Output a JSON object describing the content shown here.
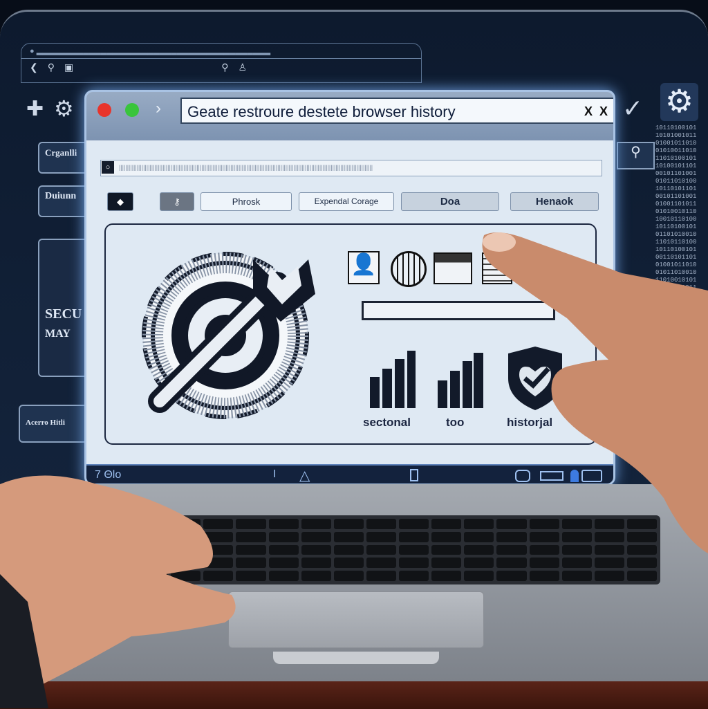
{
  "window": {
    "title": "Geate restroure destete browser history",
    "close_labels": [
      "X",
      "X"
    ]
  },
  "background_ui": {
    "left_buttons": [
      "Crganlli",
      "Duiunn",
      "SECU",
      "MAY",
      "Acerro Hitli"
    ],
    "right_icon": "gear-icon"
  },
  "toolbar": {
    "buttons": [
      "Phrosk",
      "Expendal Corage",
      "Doa",
      "Henaok"
    ]
  },
  "panel": {
    "labels": [
      "sectonal",
      "too",
      "historjal"
    ],
    "progress_fraction": 0
  },
  "statusbar": {
    "left_text": "7  Θlo"
  },
  "colors": {
    "close_dot": "#e8342b",
    "maximize_dot": "#39c53c",
    "dialog_bg": "#dfe9f3",
    "screen_bg": "#0d1a2e"
  }
}
